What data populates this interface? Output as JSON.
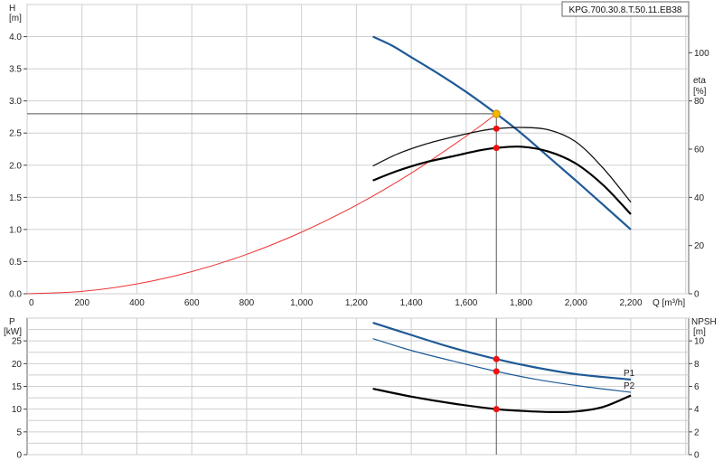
{
  "chart_data": [
    {
      "type": "line",
      "model": "KPG.700.30.8.T.50.11.EB38",
      "x_axis": {
        "label": "Q [m³/h]",
        "range": [
          0,
          2200
        ],
        "ticks": [
          0,
          200,
          400,
          600,
          800,
          1000,
          1200,
          1400,
          1600,
          1800,
          2000,
          2200
        ],
        "tick_labels": [
          "0",
          "200",
          "400",
          "600",
          "800",
          "1,000",
          "1,200",
          "1,400",
          "1,600",
          "1,800",
          "2,000",
          "2,200"
        ]
      },
      "y_axis_left": {
        "label_line1": "H",
        "label_line2": "[m]",
        "range": [
          0,
          4.5
        ],
        "ticks": [
          0,
          0.5,
          1,
          1.5,
          2,
          2.5,
          3,
          3.5,
          4
        ],
        "tick_labels": [
          "0.0",
          "0.5",
          "1.0",
          "1.5",
          "2.0",
          "2.5",
          "3.0",
          "3.5",
          "4.0"
        ]
      },
      "y_axis_right": {
        "label_line1": "eta",
        "label_line2": "[%]",
        "range": [
          0,
          120
        ],
        "ticks": [
          0,
          20,
          40,
          60,
          80,
          100
        ],
        "tick_labels": [
          "0",
          "20",
          "40",
          "60",
          "80",
          "100"
        ]
      },
      "grid": true,
      "duty_point": {
        "x": 1710,
        "y": 2.8
      },
      "series": [
        {
          "key": "head",
          "axis": "left",
          "color": "#1f5a96",
          "x": [
            1260,
            1330,
            1400,
            1500,
            1600,
            1710,
            1800,
            1900,
            2000,
            2100,
            2200
          ],
          "y": [
            4.0,
            3.86,
            3.68,
            3.42,
            3.14,
            2.8,
            2.5,
            2.13,
            1.76,
            1.38,
            1.0
          ]
        },
        {
          "key": "system",
          "axis": "left",
          "color": "#ee3333",
          "x": [
            0,
            200,
            400,
            600,
            800,
            1000,
            1200,
            1400,
            1600,
            1710
          ],
          "y": [
            0,
            0.037,
            0.153,
            0.345,
            0.613,
            0.958,
            1.379,
            1.877,
            2.452,
            2.8
          ]
        },
        {
          "key": "eta_1",
          "axis": "right",
          "color": "#111111",
          "x": [
            1260,
            1350,
            1450,
            1550,
            1650,
            1710,
            1800,
            1900,
            2000,
            2100,
            2200
          ],
          "y": [
            53,
            58,
            62,
            65,
            67.5,
            68.5,
            69,
            68,
            63,
            52,
            38
          ]
        },
        {
          "key": "eta_2",
          "axis": "right",
          "color": "#000000",
          "x": [
            1260,
            1350,
            1450,
            1550,
            1650,
            1710,
            1800,
            1900,
            2000,
            2100,
            2200
          ],
          "y": [
            47,
            51,
            54.5,
            57,
            59.5,
            60.5,
            61,
            59,
            54,
            45,
            33
          ]
        }
      ],
      "markers": [
        {
          "x": 1710,
          "y": 68.5,
          "axis": "right"
        },
        {
          "x": 1710,
          "y": 60.5,
          "axis": "right"
        }
      ]
    },
    {
      "type": "line",
      "x_axis": {
        "range": [
          0,
          2200
        ],
        "ticks": [
          0,
          200,
          400,
          600,
          800,
          1000,
          1200,
          1400,
          1600,
          1800,
          2000,
          2200
        ]
      },
      "y_axis_left": {
        "label_line1": "P",
        "label_line2": "[kW]",
        "range": [
          0,
          30
        ],
        "ticks": [
          0,
          5,
          10,
          15,
          20,
          25
        ],
        "tick_labels": [
          "0",
          "5",
          "10",
          "15",
          "20",
          "25"
        ]
      },
      "y_axis_right": {
        "label_line1": "NPSH",
        "label_line2": "[m]",
        "range": [
          0,
          12
        ],
        "ticks": [
          0,
          2,
          4,
          6,
          8,
          10
        ],
        "tick_labels": [
          "0",
          "2",
          "4",
          "6",
          "8",
          "10"
        ]
      },
      "grid": true,
      "series": [
        {
          "key": "p1",
          "axis": "left",
          "color": "#1f5a96",
          "label": "P1",
          "x": [
            1260,
            1400,
            1550,
            1710,
            1850,
            2000,
            2200
          ],
          "y": [
            29,
            26.3,
            23.5,
            21.0,
            19.2,
            17.7,
            16.5
          ]
        },
        {
          "key": "p2",
          "axis": "left",
          "color": "#1f5a96",
          "label": "P2",
          "x": [
            1260,
            1400,
            1550,
            1710,
            1850,
            2000,
            2200
          ],
          "y": [
            25.5,
            22.9,
            20.6,
            18.3,
            16.6,
            15.2,
            13.7
          ]
        },
        {
          "key": "npsh",
          "axis": "right",
          "color": "#000000",
          "x": [
            1260,
            1400,
            1550,
            1710,
            1800,
            1900,
            2000,
            2100,
            2200
          ],
          "y": [
            5.8,
            5.1,
            4.5,
            4.0,
            3.85,
            3.75,
            3.8,
            4.2,
            5.2
          ]
        }
      ],
      "markers": [
        {
          "x": 1710,
          "y": 21.0,
          "axis": "left"
        },
        {
          "x": 1710,
          "y": 18.3,
          "axis": "left"
        },
        {
          "x": 1710,
          "y": 4.0,
          "axis": "right"
        }
      ]
    }
  ]
}
